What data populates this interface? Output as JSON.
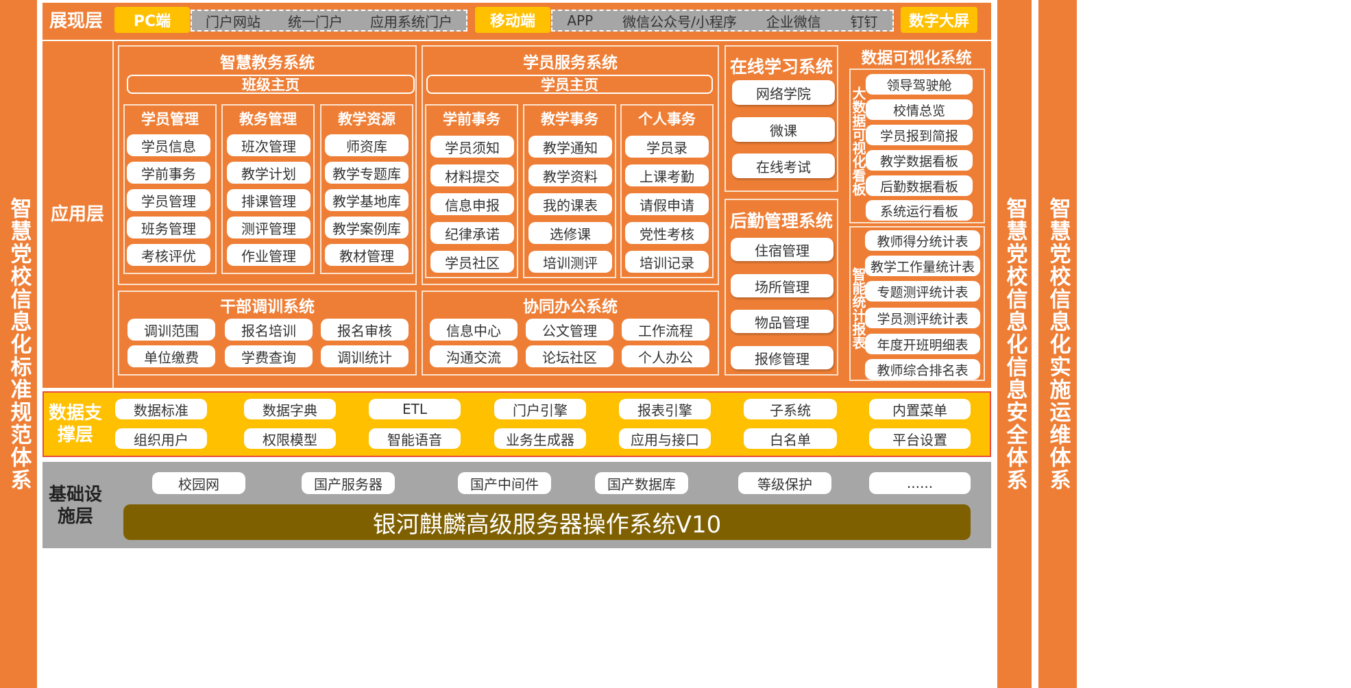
{
  "left_system": "智慧党校信息化标准规范体系",
  "right_system_1": "智慧党校信息化信息安全体系",
  "right_system_2": "智慧党校信息化实施运维体系",
  "presentation": {
    "label": "展现层",
    "pc_tab": "PC端",
    "pc_items": [
      "门户网站",
      "统一门户",
      "应用系统门户"
    ],
    "mobile_tab": "移动端",
    "mobile_items": [
      "APP",
      "微信公众号/小程序",
      "企业微信",
      "钉钉"
    ],
    "bigscreen": "数字大屏"
  },
  "application": {
    "label": "应用层",
    "jiaowu": {
      "title": "智慧教务系统",
      "home": "班级主页",
      "groups": [
        {
          "title": "学员管理",
          "items": [
            "学员信息",
            "学前事务",
            "学员管理",
            "班务管理",
            "考核评优"
          ]
        },
        {
          "title": "教务管理",
          "items": [
            "班次管理",
            "教学计划",
            "排课管理",
            "测评管理",
            "作业管理"
          ]
        },
        {
          "title": "教学资源",
          "items": [
            "师资库",
            "教学专题库",
            "教学基地库",
            "教学案例库",
            "教材管理"
          ]
        }
      ]
    },
    "xueyuan": {
      "title": "学员服务系统",
      "home": "学员主页",
      "groups": [
        {
          "title": "学前事务",
          "items": [
            "学员须知",
            "材料提交",
            "信息申报",
            "纪律承诺",
            "学员社区"
          ]
        },
        {
          "title": "教学事务",
          "items": [
            "教学通知",
            "教学资料",
            "我的课表",
            "选修课",
            "培训测评"
          ]
        },
        {
          "title": "个人事务",
          "items": [
            "学员录",
            "上课考勤",
            "请假申请",
            "党性考核",
            "培训记录"
          ]
        }
      ]
    },
    "online": {
      "title": "在线学习系统",
      "items": [
        "网络学院",
        "微课",
        "在线考试"
      ]
    },
    "houqin": {
      "title": "后勤管理系统",
      "items": [
        "住宿管理",
        "场所管理",
        "物品管理",
        "报修管理"
      ]
    },
    "visual": {
      "title": "数据可视化系统",
      "board_label": "大数据可视化看板",
      "board_items": [
        "领导驾驶舱",
        "校情总览",
        "学员报到简报",
        "教学数据看板",
        "后勤数据看板",
        "系统运行看板"
      ],
      "stats_label": "智能统计报表",
      "stats_items": [
        "教师得分统计表",
        "教学工作量统计表",
        "专题测评统计表",
        "学员测评统计表",
        "年度开班明细表",
        "教师综合排名表"
      ]
    },
    "ganbu": {
      "title": "干部调训系统",
      "items": [
        "调训范围",
        "报名培训",
        "报名审核",
        "单位缴费",
        "学费查询",
        "调训统计"
      ]
    },
    "xietong": {
      "title": "协同办公系统",
      "items": [
        "信息中心",
        "公文管理",
        "工作流程",
        "沟通交流",
        "论坛社区",
        "个人办公"
      ]
    }
  },
  "data_support": {
    "label": "数据支撑层",
    "row1": [
      "数据标准",
      "数据字典",
      "ETL",
      "门户引擎",
      "报表引擎",
      "子系统",
      "内置菜单"
    ],
    "row2": [
      "组织用户",
      "权限模型",
      "智能语音",
      "业务生成器",
      "应用与接口",
      "白名单",
      "平台设置"
    ]
  },
  "infrastructure": {
    "label": "基础设施层",
    "items": [
      "校园网",
      "国产服务器",
      "国产中间件",
      "国产数据库",
      "等级保护",
      "......"
    ],
    "os": "银河麒麟高级服务器操作系统V10"
  },
  "colors": {
    "orange": "#ee7e35",
    "yellow": "#ffc000",
    "grey": "#a6a6a6",
    "olive": "#7f6000"
  }
}
